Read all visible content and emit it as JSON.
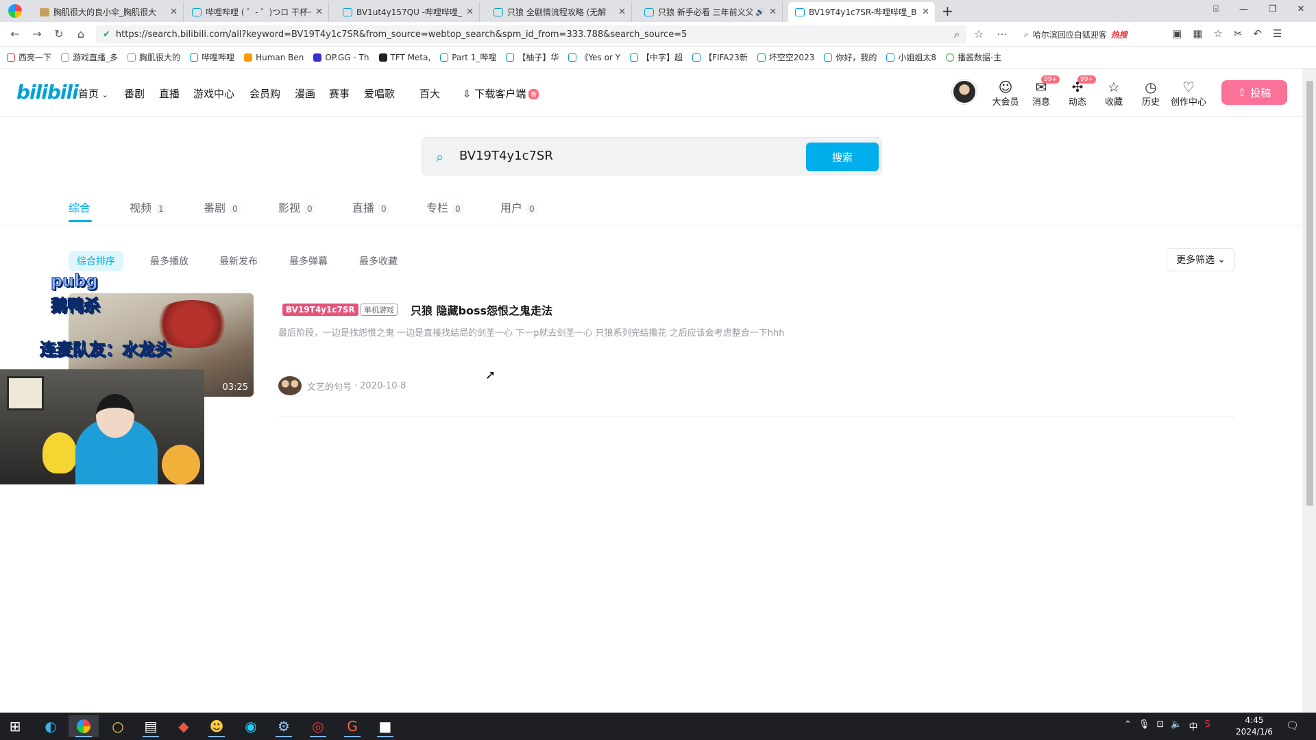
{
  "browser": {
    "tabs": [
      {
        "title": "胸肌很大的良小伞_胸肌很大",
        "active": false
      },
      {
        "title": "哔哩哔哩 ( ゜- ゜)つロ 干杯~",
        "active": false
      },
      {
        "title": "BV1ut4y157QU -哔哩哔哩_B",
        "active": false
      },
      {
        "title": "只狼 全剧情流程攻略 (无解",
        "active": false
      },
      {
        "title": "只狼 新手必看 三年前义父",
        "active": false
      },
      {
        "title": "BV19T4y1c7SR-哔哩哔哩_B",
        "active": true
      }
    ],
    "new_tab": "+",
    "url": "https://search.bilibili.com/all?keyword=BV19T4y1c7SR&from_source=webtop_search&spm_id_from=333.788&search_source=5",
    "side_search": "哈尔滨回应白狐迎客",
    "side_search_hot": "热搜",
    "bookmarks": [
      "西亮一下",
      "游戏直播_多",
      "胸肌很大的",
      "哔哩哔哩",
      "Human Ben",
      "OP.GG - Th",
      "TFT Meta,",
      "Part 1_哔哩",
      "【柚子】华",
      "《Yes or Y",
      "【中字】超",
      "【FIFA23新",
      "坏空空2023",
      "你好，我的",
      "小姐姐太8",
      "播酱数据-主"
    ]
  },
  "header": {
    "logo": "bilibili",
    "nav": [
      "首页",
      "番剧",
      "直播",
      "游戏中心",
      "会员购",
      "漫画",
      "赛事",
      "爱唱歌",
      "百大"
    ],
    "download": "下载客户端",
    "download_badge": "新",
    "icons": [
      {
        "label": "大会员",
        "icon": "vip-icon"
      },
      {
        "label": "消息",
        "icon": "message-icon",
        "count": "99+"
      },
      {
        "label": "动态",
        "icon": "dynamic-icon",
        "count": "99+"
      },
      {
        "label": "收藏",
        "icon": "star-icon"
      },
      {
        "label": "历史",
        "icon": "clock-icon"
      },
      {
        "label": "创作中心",
        "icon": "bulb-icon"
      }
    ],
    "upload": "投稿"
  },
  "search": {
    "value": "BV19T4y1c7SR",
    "button": "搜索"
  },
  "result_tabs": [
    {
      "label": "综合",
      "count": ""
    },
    {
      "label": "视频",
      "count": "1"
    },
    {
      "label": "番剧",
      "count": "0"
    },
    {
      "label": "影视",
      "count": "0"
    },
    {
      "label": "直播",
      "count": "0"
    },
    {
      "label": "专栏",
      "count": "0"
    },
    {
      "label": "用户",
      "count": "0"
    }
  ],
  "sort_tabs": [
    "综合排序",
    "最多播放",
    "最新发布",
    "最多弹幕",
    "最多收藏"
  ],
  "more_filter": "更多筛选",
  "result": {
    "bv_tag": "BV19T4y1c7SR",
    "category": "单机游戏",
    "title": "只狼 隐藏boss怨恨之鬼走法",
    "desc": "最后阶段，一边是找怨恨之鬼 一边是直接找结局的剑圣一心 下一p就去剑圣一心 只狼系列完结撒花 之后应该会考虑整合一下hhh",
    "duration": "03:25",
    "author": "文艺的句号",
    "date": "2020-10-8"
  },
  "overlay": {
    "line1": "pubg",
    "line2": "鹅鸭杀",
    "line3": "连麦队友：水龙头"
  },
  "taskbar": {
    "time": "4:45",
    "date": "2024/1/6",
    "ime": "中"
  }
}
